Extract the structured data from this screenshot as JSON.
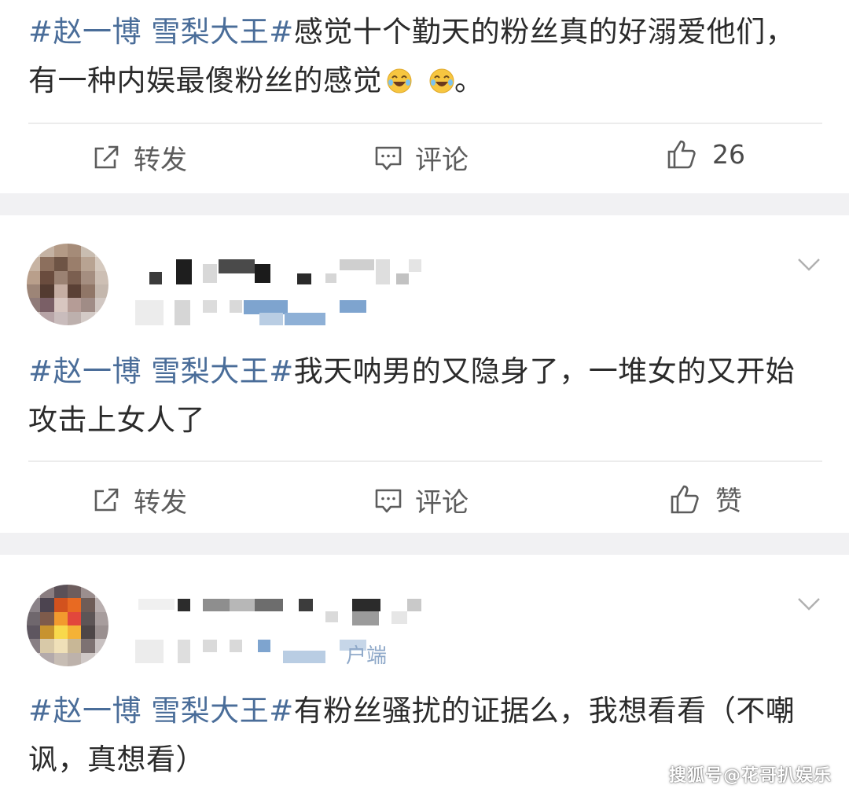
{
  "posts": [
    {
      "tag": "#赵一博 雪梨大王#",
      "text": "感觉十个勤天的粉丝真的好溺爱他们，有一种内娱最傻粉丝的感觉",
      "emoji": "😂😂",
      "trailing": "。",
      "actions": {
        "repost": "转发",
        "comment": "评论",
        "like": "26"
      }
    },
    {
      "tag": "#赵一博 雪梨大王#",
      "text": "我天呐男的又隐身了，一堆女的又开始攻击上女人了",
      "actions": {
        "repost": "转发",
        "comment": "评论",
        "like": "赞"
      }
    },
    {
      "tag": "#赵一博 雪梨大王#",
      "text": "有粉丝骚扰的证据么，我想看看（不嘲讽，真想看）",
      "device_fragment": "户端"
    }
  ],
  "watermark": "搜狐号@花哥扒娱乐",
  "colors": {
    "tag": "#4a6d99",
    "text": "#2b2b2b",
    "separator": "#f1f1f3",
    "icon": "#5c5c5c"
  },
  "icons": [
    "repost-icon",
    "comment-icon",
    "like-icon",
    "chevron-down-icon",
    "laughing-emoji-icon"
  ]
}
